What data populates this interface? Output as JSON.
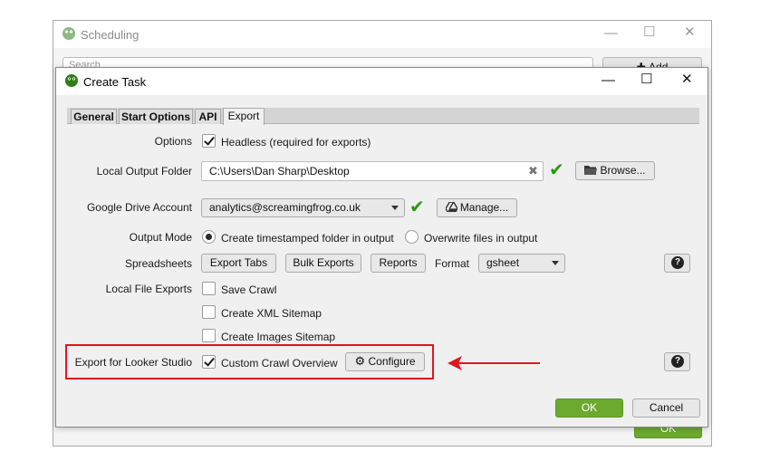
{
  "background_window": {
    "title": "Scheduling",
    "search_placeholder": "Search",
    "add_label": "Add",
    "ok_label": "OK"
  },
  "dialog": {
    "title": "Create Task",
    "tabs": [
      {
        "label": "General"
      },
      {
        "label": "Start Options"
      },
      {
        "label": "API"
      },
      {
        "label": "Export"
      }
    ],
    "options": {
      "label": "Options",
      "headless_label": "Headless (required for exports)",
      "headless_checked": true
    },
    "output_folder": {
      "label": "Local Output Folder",
      "value": "C:\\Users\\Dan Sharp\\Desktop",
      "browse_label": "Browse..."
    },
    "drive": {
      "label": "Google Drive Account",
      "selected": "analytics@screamingfrog.co.uk",
      "manage_label": "Manage..."
    },
    "output_mode": {
      "label": "Output Mode",
      "option1": "Create timestamped folder in output",
      "option2": "Overwrite files in output",
      "selected": "option1"
    },
    "spreadsheets": {
      "label": "Spreadsheets",
      "export_tabs": "Export Tabs",
      "bulk_exports": "Bulk Exports",
      "reports": "Reports",
      "format_label": "Format",
      "format_value": "gsheet"
    },
    "local_file_exports": {
      "label": "Local File Exports",
      "items": [
        {
          "label": "Save Crawl",
          "checked": false
        },
        {
          "label": "Create XML Sitemap",
          "checked": false
        },
        {
          "label": "Create Images Sitemap",
          "checked": false
        }
      ]
    },
    "looker": {
      "label": "Export for Looker Studio",
      "checkbox_label": "Custom Crawl Overview",
      "checked": true,
      "configure_label": "Configure"
    },
    "footer": {
      "ok_label": "OK",
      "cancel_label": "Cancel"
    }
  },
  "annotation": {
    "highlight_color": "#e0161d"
  },
  "colors": {
    "accent_green": "#6caa2f",
    "valid_check": "#2a9a12"
  }
}
